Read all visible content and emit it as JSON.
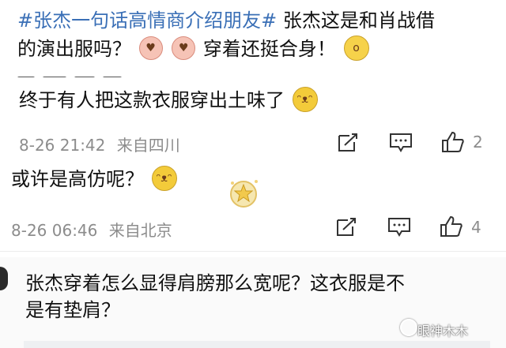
{
  "post": {
    "hashtag": "#张杰一句话高情商介绍朋友#",
    "line1_rest": "张杰这是和肖战借",
    "line2_a": "的演出服吗？",
    "line2_b": "穿着还挺合身！"
  },
  "comments": [
    {
      "text": "终于有人把这款衣服穿出土味了",
      "time": "8-26 21:42",
      "source": "来自四川",
      "likes": "2"
    },
    {
      "text": "或许是高仿呢？",
      "time": "8-26 06:46",
      "source": "来自北京",
      "likes": "4"
    }
  ],
  "reply": {
    "text_line1": "张杰穿着怎么显得肩膀那么宽呢？这衣服是不",
    "text_line2": "是有垫肩？"
  },
  "watermark": "眼神木木",
  "icons": {
    "emoji_love": "love-eyes-emoji-icon",
    "emoji_shock": "shocked-emoji-icon",
    "emoji_laugh": "laugh-cry-emoji-icon",
    "share": "share-icon",
    "comment": "comment-icon",
    "like": "thumbs-up-icon",
    "medal": "medal-badge-icon"
  },
  "colors": {
    "hashtag": "#3a6fb6",
    "meta": "#8c8c8c",
    "background": "#ffffff"
  }
}
